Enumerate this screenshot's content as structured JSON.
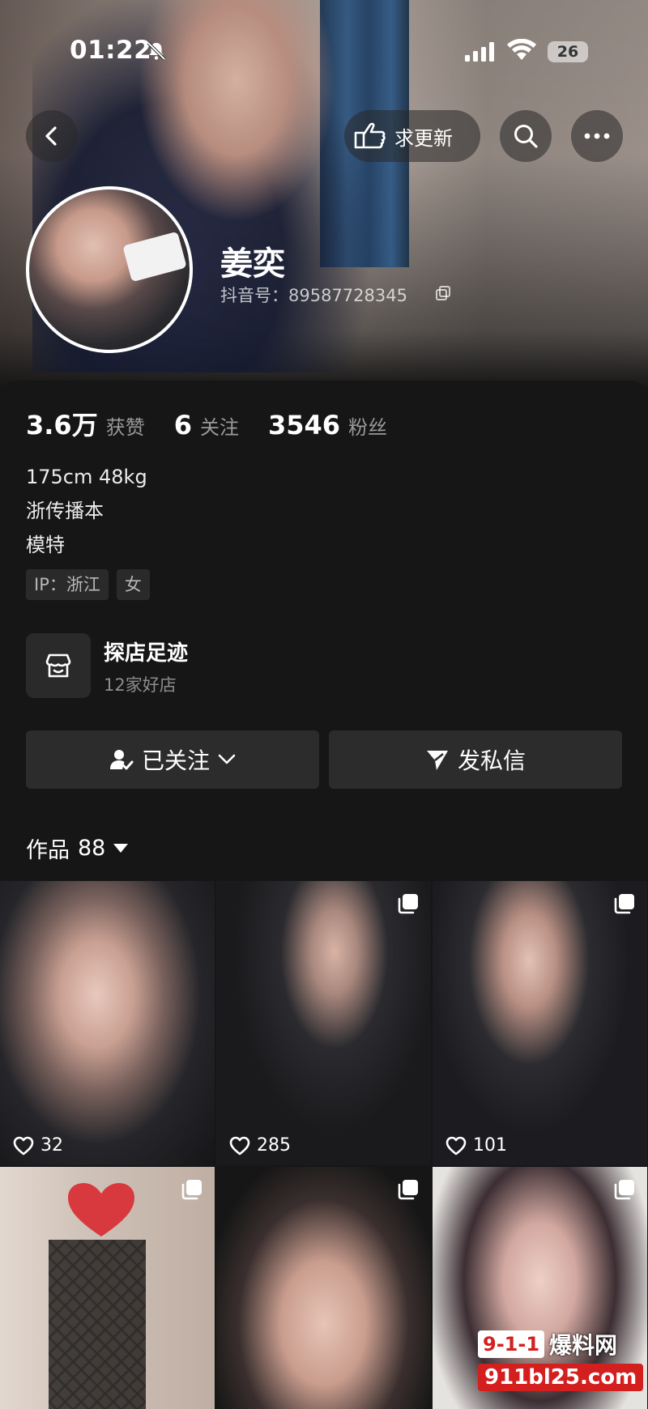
{
  "status_bar": {
    "time": "01:22",
    "battery": "26"
  },
  "nav": {
    "update_label": "求更新"
  },
  "profile": {
    "name": "姜奕",
    "douyin_id": "抖音号：89587728345"
  },
  "stats": [
    {
      "value": "3.6万",
      "label": "获赞"
    },
    {
      "value": "6",
      "label": "关注"
    },
    {
      "value": "3546",
      "label": "粉丝"
    }
  ],
  "bio": {
    "line1": "175cm 48kg",
    "line2": "浙传播本",
    "line3": "模特"
  },
  "tags": {
    "ip": "IP：浙江",
    "gender": "女"
  },
  "store": {
    "title": "探店足迹",
    "subtitle": "12家好店"
  },
  "actions": {
    "follow": "已关注",
    "message": "发私信"
  },
  "works": {
    "label": "作品",
    "count": "88"
  },
  "grid": [
    {
      "likes": "32",
      "multi": false
    },
    {
      "likes": "285",
      "multi": true
    },
    {
      "likes": "101",
      "multi": true
    },
    {
      "multi": true
    },
    {
      "multi": true
    },
    {
      "multi": true
    }
  ],
  "watermark": {
    "logo": "9-1-1",
    "name": "爆料网",
    "url": "911bl25.com"
  },
  "colors": {
    "background": "#161616",
    "button": "#2c2c2c",
    "muted_text": "#9a9a9a"
  }
}
